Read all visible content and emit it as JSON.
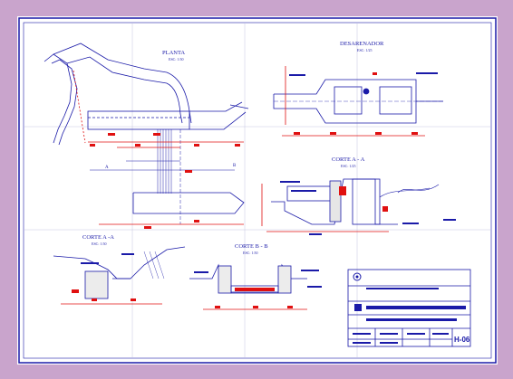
{
  "sheet": {
    "background_color": "#c9a4cc",
    "paper_color": "#ffffff",
    "line_color": "#1a1aa8",
    "dimension_color": "#e01010"
  },
  "views": {
    "planta": {
      "title": "PLANTA",
      "scale": "ESC: 1:50"
    },
    "desarenador": {
      "title": "DESARENADOR",
      "scale": "ESC: 1/25"
    },
    "corte_aa_right": {
      "title": "CORTE A - A",
      "scale": "ESC: 1/25"
    },
    "corte_aa_left": {
      "title": "CORTE A -A",
      "scale": "ESC: 1:50"
    },
    "corte_bb": {
      "title": "CORTE B - B",
      "scale": "ESC: 1:50"
    }
  },
  "markers": {
    "a": "A",
    "b": "B"
  },
  "title_block": {
    "sheet_number": "H-06"
  }
}
